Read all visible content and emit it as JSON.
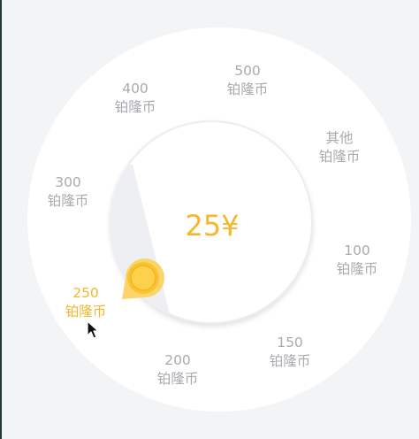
{
  "amount_display": "25¥",
  "options": [
    {
      "value": "500",
      "unit": "铂隆币",
      "selected": false
    },
    {
      "value": "其他",
      "unit": "铂隆币",
      "selected": false
    },
    {
      "value": "100",
      "unit": "铂隆币",
      "selected": false
    },
    {
      "value": "150",
      "unit": "铂隆币",
      "selected": false
    },
    {
      "value": "200",
      "unit": "铂隆币",
      "selected": false
    },
    {
      "value": "250",
      "unit": "铂隆币",
      "selected": true
    },
    {
      "value": "300",
      "unit": "铂隆币",
      "selected": false
    },
    {
      "value": "400",
      "unit": "铂隆币",
      "selected": false
    }
  ],
  "colors": {
    "accent": "#f5b72b",
    "muted_text": "#a9aaaf",
    "background": "#f3f4f6",
    "ring": "#ffffff",
    "wedge": "#eeeff3"
  },
  "icons": {
    "pointer": "dial-pointer-knob-icon",
    "cursor": "mouse-cursor-icon"
  }
}
